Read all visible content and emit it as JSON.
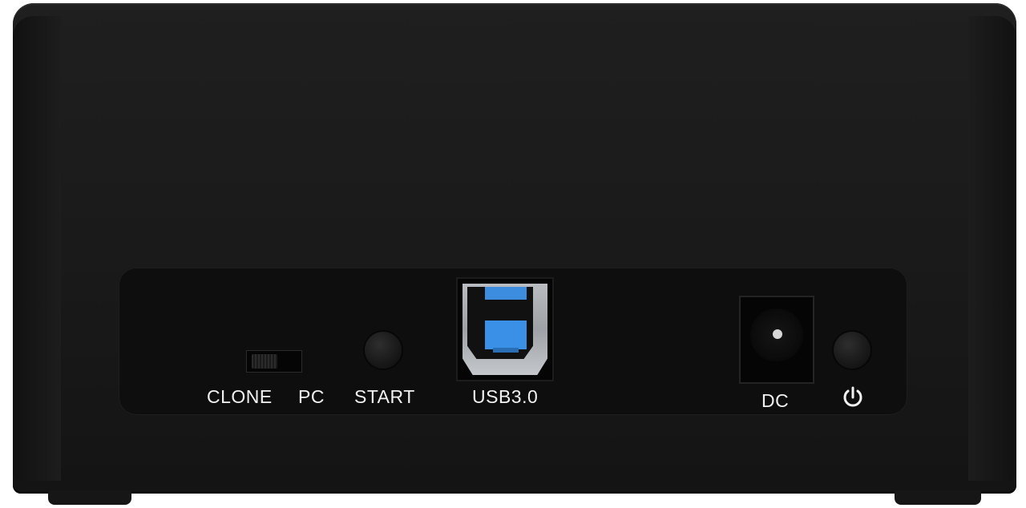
{
  "device": {
    "body_color": "#1a1a1a",
    "accent_color": "#3a8fe6",
    "label_color": "#f2f2f2"
  },
  "labels": {
    "clone": "CLONE",
    "pc": "PC",
    "start": "START",
    "usb": "USB3.0",
    "dc": "DC"
  },
  "icons": {
    "power": "power-icon",
    "switch": "mode-switch",
    "usb": "usb-b-port-icon",
    "dc": "dc-jack-icon"
  }
}
